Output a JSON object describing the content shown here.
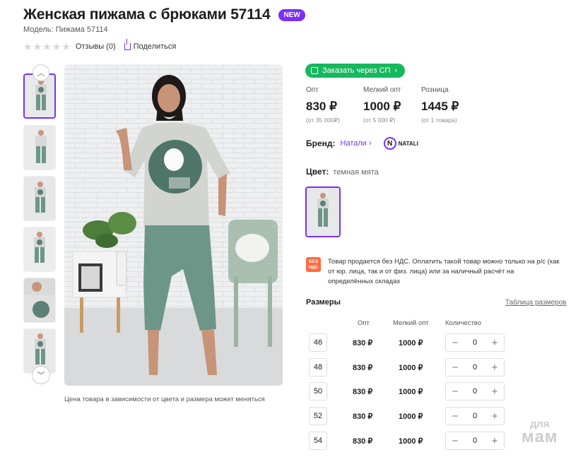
{
  "product": {
    "title": "Женская пижама с брюками 57114",
    "badge": "NEW",
    "model": "Модель: Пижама 57114",
    "reviews": "Отзывы (0)",
    "share": "Поделиться"
  },
  "gallery": {
    "caption": "Цена товара в зависимости от цвета и размера может меняться",
    "thumb_count": 6
  },
  "order": {
    "sp_button": "Заказать через СП"
  },
  "prices": [
    {
      "label": "Опт",
      "value": "830 ₽",
      "note": "(от 35 000₽)"
    },
    {
      "label": "Мелкий опт",
      "value": "1000 ₽",
      "note": "(от 5 000 ₽)"
    },
    {
      "label": "Розница",
      "value": "1445 ₽",
      "note": "(от 1 товара)"
    }
  ],
  "brand": {
    "label": "Бренд:",
    "name": "Натали",
    "logo_text": "NATALI",
    "logo_letter": "N"
  },
  "color": {
    "label": "Цвет:",
    "value": "темная мята"
  },
  "nds": {
    "icon_line1": "БЕЗ",
    "icon_line2": "НДС",
    "text": "Товар продается без НДС. Оплатить такой товар можно только на р/с (как от юр. лица, так и от физ. лица) или за наличный расчёт на определённых складах"
  },
  "sizes": {
    "title": "Размеры",
    "table_link": "Таблица размеров",
    "headers": {
      "opt": "Опт",
      "small_opt": "Мелкий опт",
      "qty": "Количество"
    },
    "rows": [
      {
        "size": "46",
        "opt": "830 ₽",
        "small_opt": "1000 ₽",
        "qty": "0"
      },
      {
        "size": "48",
        "opt": "830 ₽",
        "small_opt": "1000 ₽",
        "qty": "0"
      },
      {
        "size": "50",
        "opt": "830 ₽",
        "small_opt": "1000 ₽",
        "qty": "0"
      },
      {
        "size": "52",
        "opt": "830 ₽",
        "small_opt": "1000 ₽",
        "qty": "0"
      },
      {
        "size": "54",
        "opt": "830 ₽",
        "small_opt": "1000 ₽",
        "qty": "0"
      }
    ]
  },
  "watermark": {
    "line1": "для",
    "line2": "мам"
  },
  "colors": {
    "accent": "#7b2ff7",
    "green": "#16b85e",
    "nds": "#ff6a3d"
  }
}
